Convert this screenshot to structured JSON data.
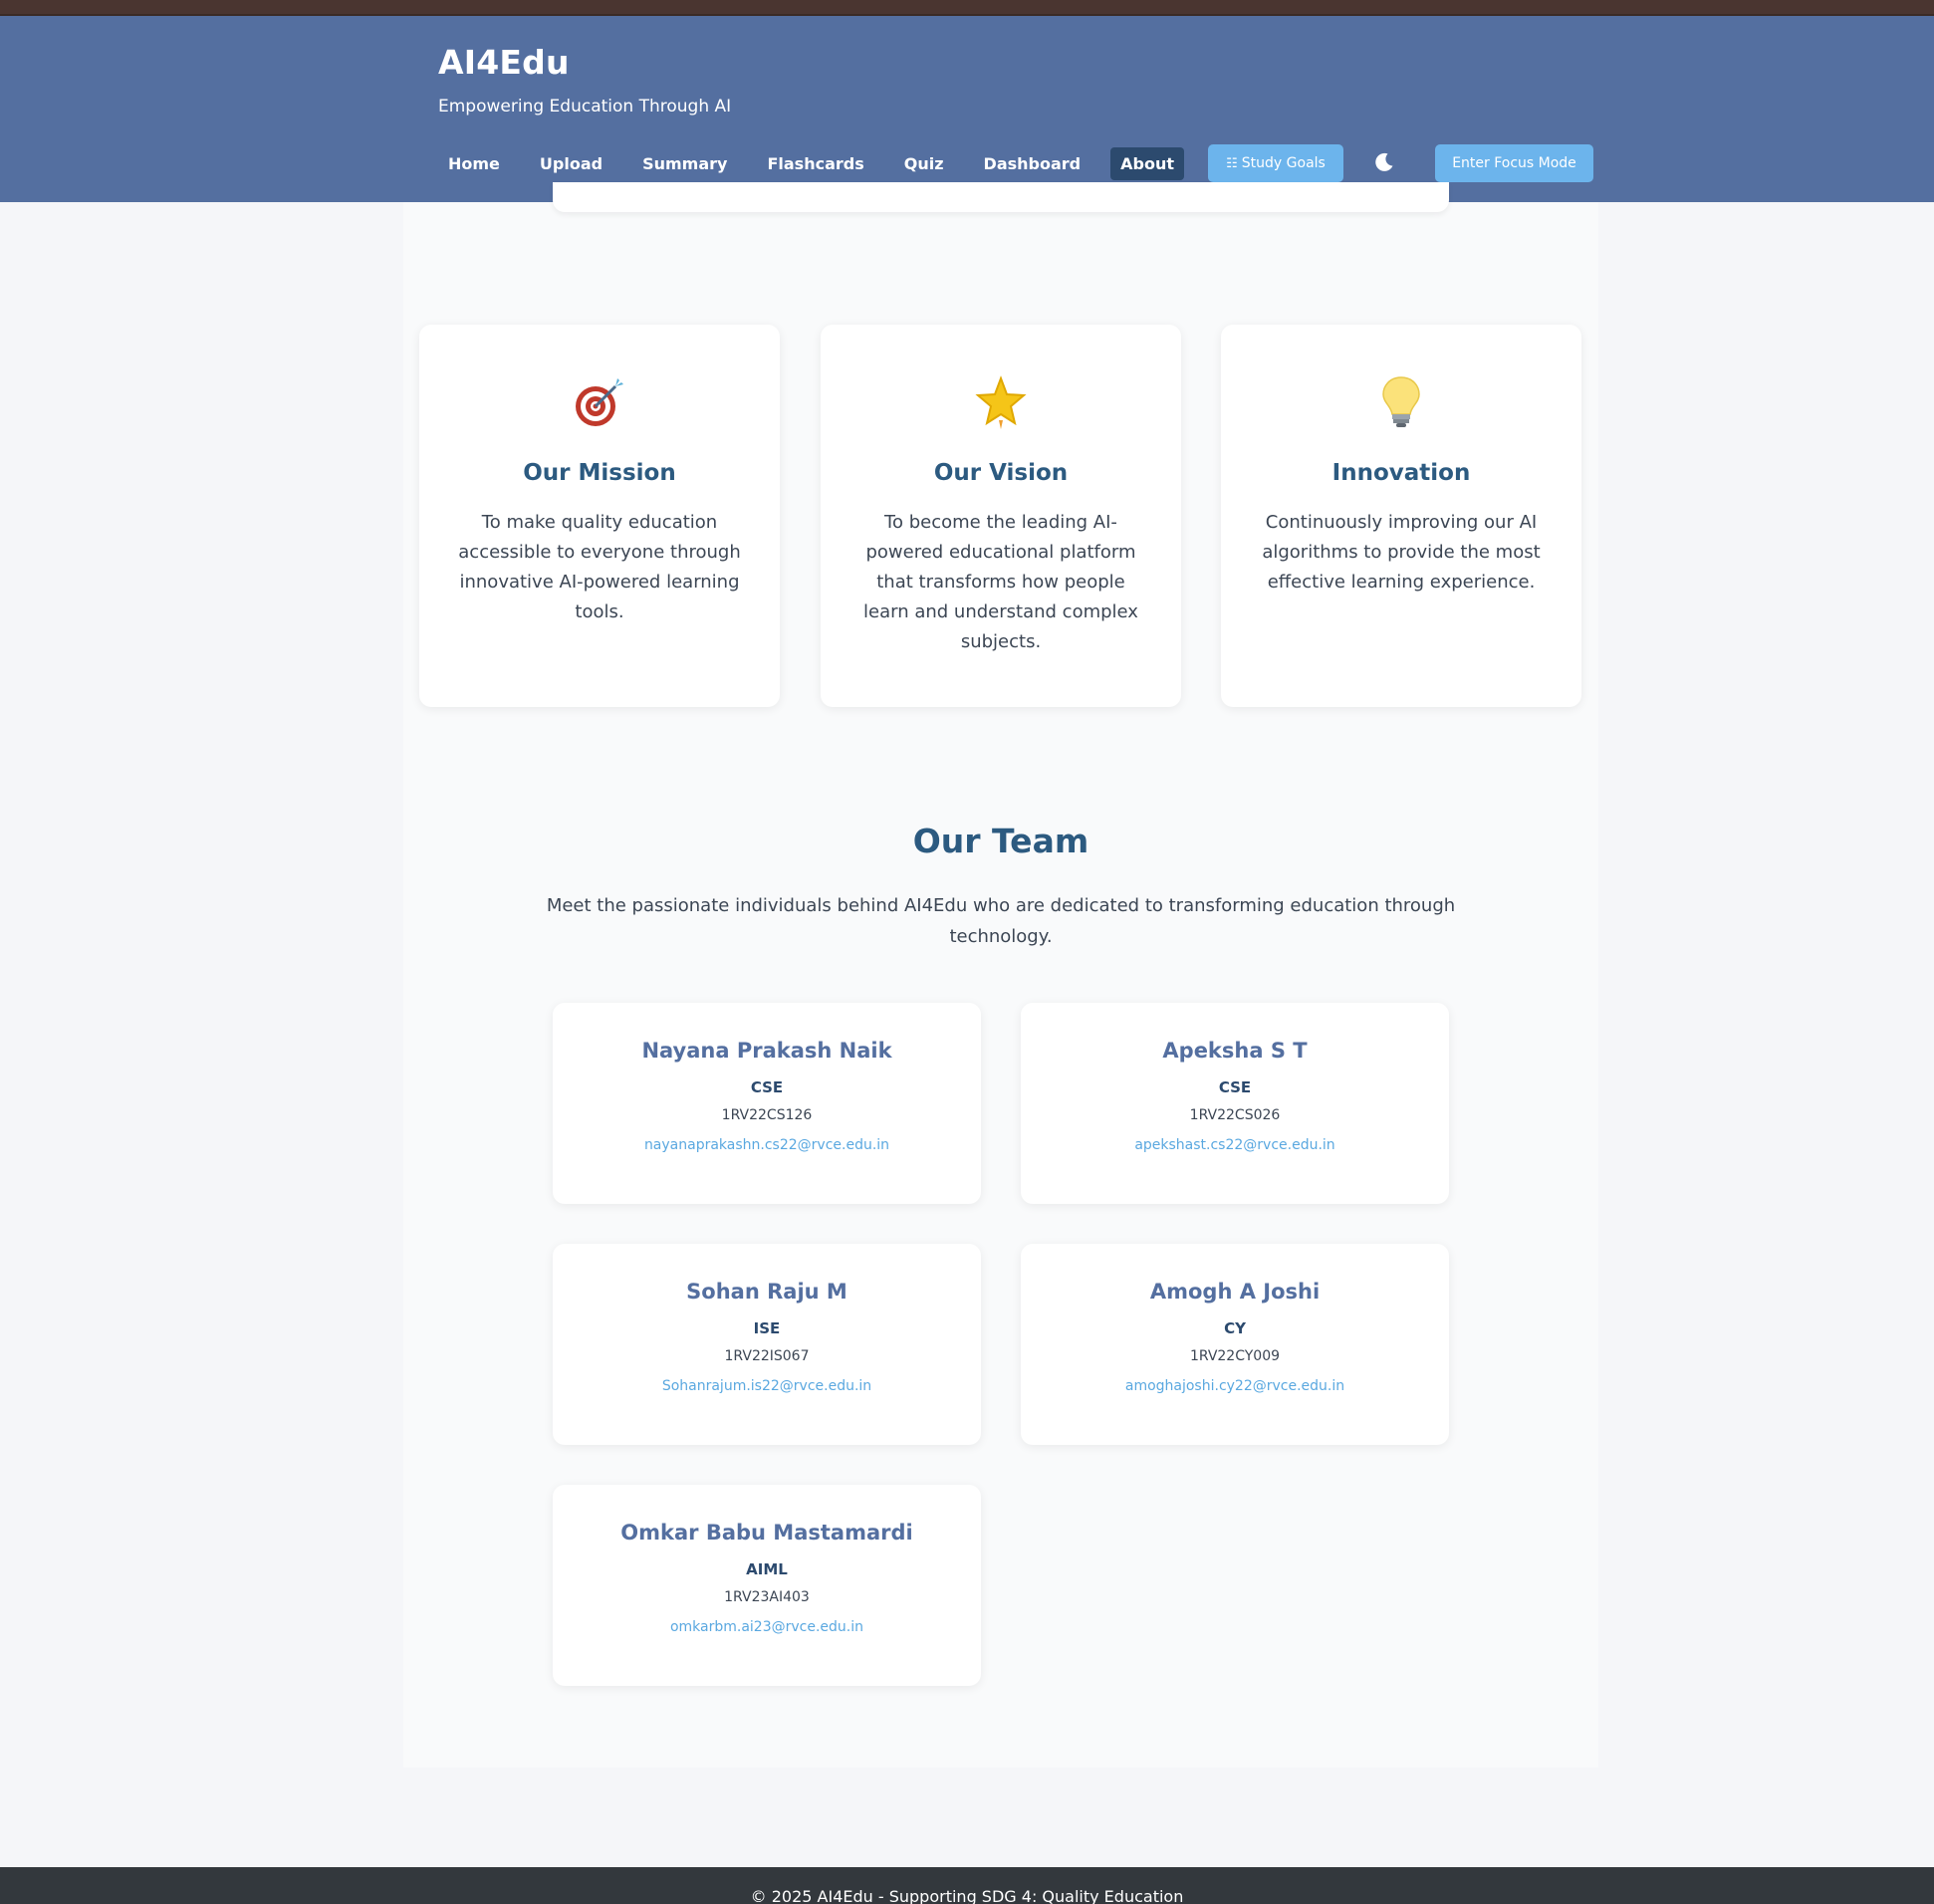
{
  "header": {
    "brand": "AI4Edu",
    "tagline": "Empowering Education Through AI",
    "nav": [
      "Home",
      "Upload",
      "Summary",
      "Flashcards",
      "Quiz",
      "Dashboard",
      "About"
    ],
    "active_nav": "About",
    "study_goals_label": "Study Goals",
    "focus_mode_label": "Enter Focus Mode"
  },
  "features": [
    {
      "icon": "target-icon",
      "title": "Our Mission",
      "text": "To make quality education accessible to everyone through innovative AI-powered learning tools."
    },
    {
      "icon": "star-icon",
      "title": "Our Vision",
      "text": "To become the leading AI-powered educational platform that transforms how people learn and understand complex subjects."
    },
    {
      "icon": "lightbulb-icon",
      "title": "Innovation",
      "text": "Continuously improving our AI algorithms to provide the most effective learning experience."
    }
  ],
  "team": {
    "title": "Our Team",
    "description": "Meet the passionate individuals behind AI4Edu who are dedicated to transforming education through technology.",
    "members": [
      {
        "name": "Nayana Prakash Naik",
        "dept": "CSE",
        "usn": "1RV22CS126",
        "email": "nayanaprakashn.cs22@rvce.edu.in"
      },
      {
        "name": "Apeksha S T",
        "dept": "CSE",
        "usn": "1RV22CS026",
        "email": "apekshast.cs22@rvce.edu.in"
      },
      {
        "name": "Sohan Raju M",
        "dept": "ISE",
        "usn": "1RV22IS067",
        "email": "Sohanrajum.is22@rvce.edu.in"
      },
      {
        "name": "Amogh A Joshi",
        "dept": "CY",
        "usn": "1RV22CY009",
        "email": "amoghajoshi.cy22@rvce.edu.in"
      },
      {
        "name": "Omkar Babu Mastamardi",
        "dept": "AIML",
        "usn": "1RV23AI403",
        "email": "omkarbm.ai23@rvce.edu.in"
      }
    ]
  },
  "footer": {
    "text": "© 2025 AI4Edu - Supporting SDG 4: Quality Education"
  },
  "colors": {
    "header_bg": "#546fa0",
    "active_nav_bg": "#2c4a6e",
    "button_bg": "#6cb4ec",
    "heading": "#2c5a80",
    "member_name": "#546fa0",
    "email_link": "#5aa8e0",
    "footer_bg": "#33383d"
  }
}
